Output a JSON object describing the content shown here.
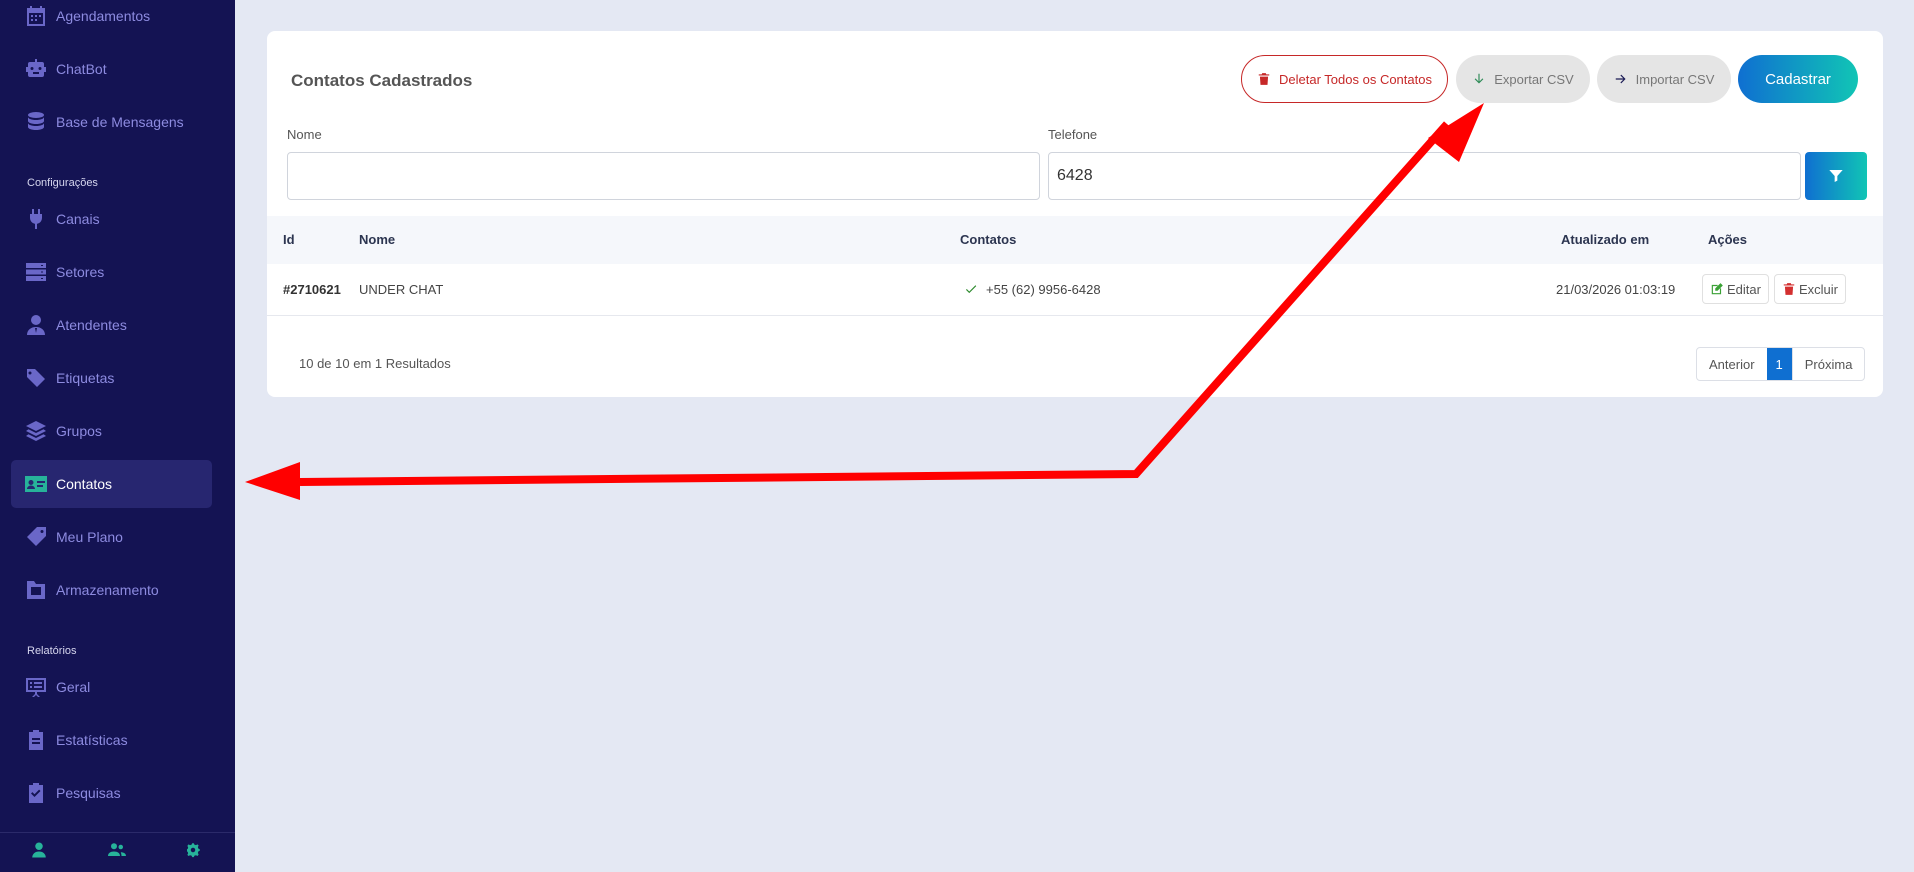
{
  "sidebar": {
    "items": [
      {
        "label": "Agendamentos",
        "icon": "calendar-icon"
      },
      {
        "label": "ChatBot",
        "icon": "robot-icon"
      },
      {
        "label": "Base de Mensagens",
        "icon": "database-icon"
      },
      {
        "label": "Canais",
        "icon": "plug-icon"
      },
      {
        "label": "Setores",
        "icon": "server-icon"
      },
      {
        "label": "Atendentes",
        "icon": "user-tie-icon"
      },
      {
        "label": "Etiquetas",
        "icon": "tags-icon"
      },
      {
        "label": "Grupos",
        "icon": "layers-icon"
      },
      {
        "label": "Contatos",
        "icon": "address-card-icon",
        "active": true
      },
      {
        "label": "Meu Plano",
        "icon": "plan-tag-icon"
      },
      {
        "label": "Armazenamento",
        "icon": "folder-icon"
      },
      {
        "label": "Geral",
        "icon": "presentation-icon"
      },
      {
        "label": "Estatísticas",
        "icon": "clipboard-icon"
      },
      {
        "label": "Pesquisas",
        "icon": "clipboard-check-icon"
      }
    ],
    "sections": {
      "config": "Configurações",
      "reports": "Relatórios"
    },
    "footer_icons": [
      "user-icon",
      "users-icon",
      "cogs-icon"
    ]
  },
  "card": {
    "title": "Contatos Cadastrados",
    "buttons": {
      "delete_all": "Deletar Todos os Contatos",
      "export": "Exportar CSV",
      "import": "Importar CSV",
      "create": "Cadastrar"
    },
    "filters": {
      "name_label": "Nome",
      "name_value": "",
      "phone_label": "Telefone",
      "phone_value": "6428"
    }
  },
  "table": {
    "headers": {
      "id": "Id",
      "name": "Nome",
      "contacts": "Contatos",
      "updated": "Atualizado em",
      "actions": "Ações"
    },
    "rows": [
      {
        "id": "#2710621",
        "name": "UNDER CHAT",
        "contact": "+55 (62) 9956-6428",
        "updated": "21/03/2026 01:03:19",
        "edit": "Editar",
        "delete": "Excluir"
      }
    ]
  },
  "footer": {
    "results": "10 de 10 em 1 Resultados",
    "pager": {
      "prev": "Anterior",
      "current": "1",
      "next": "Próxima"
    }
  },
  "colors": {
    "sidebar_bg": "#141353",
    "accent": "#0f6fd1",
    "annotation_arrow": "#ff0000"
  }
}
